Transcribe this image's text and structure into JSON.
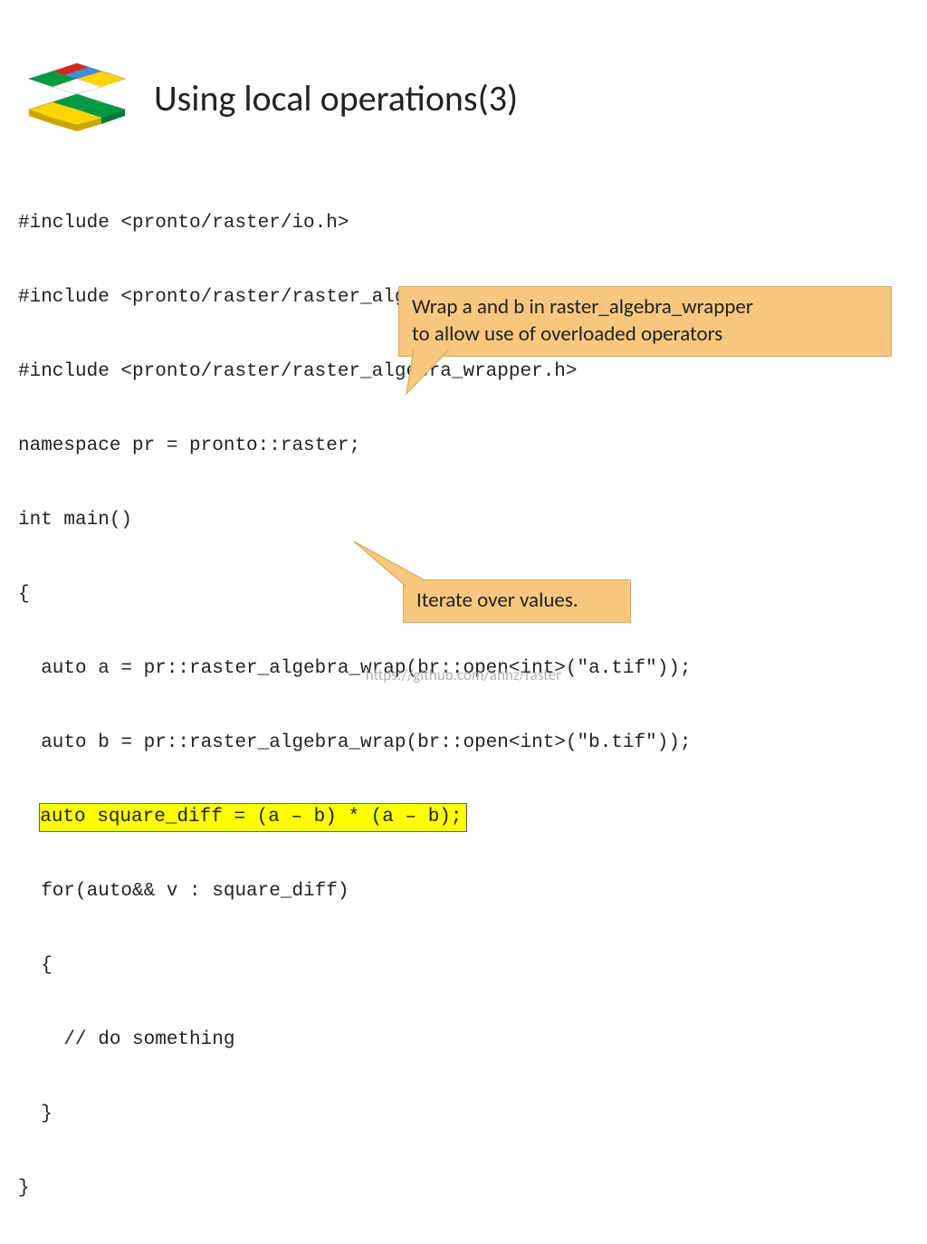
{
  "title": "Using local operations(3)",
  "code": {
    "l1": "#include <pronto/raster/io.h>",
    "l2": "#include <pronto/raster/raster_algebra_operators.h>",
    "l3": "#include <pronto/raster/raster_algebra_wrapper.h>",
    "l4": "namespace pr = pronto::raster;",
    "l5": "int main()",
    "l6": "{",
    "l7": "  auto a = pr::raster_algebra_wrap(br::open<int>(\"a.tif\"));",
    "l8": "  auto b = pr::raster_algebra_wrap(br::open<int>(\"b.tif\"));",
    "l9_prefix": "  ",
    "l9_hl": "auto square_diff = (a – b) * (a – b);",
    "l10": "  for(auto&& v : square_diff)",
    "l11": "  {",
    "l12": "    // do something",
    "l13": "  }",
    "l14": "}"
  },
  "callout_top_line1": "Wrap a and b in raster_algebra_wrapper",
  "callout_top_line2": "to allow use of overloaded operators",
  "callout_bottom": "Iterate over values.",
  "footer": "https://github.com/ahhz/raster"
}
